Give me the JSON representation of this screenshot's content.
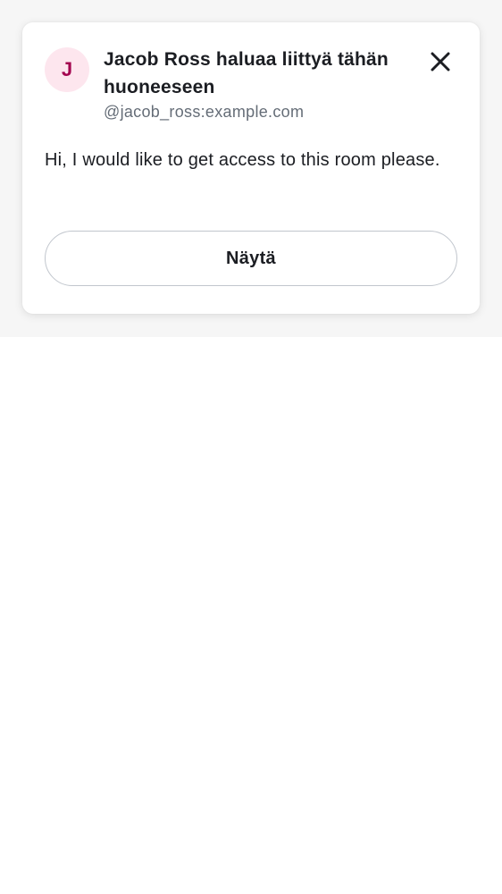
{
  "request": {
    "avatar_initial": "J",
    "title": "Jacob Ross haluaa liittyä tähän huoneeseen",
    "user_id": "@jacob_ross:example.com",
    "message": "Hi, I would like to get access to this room please.",
    "view_button_label": "Näytä"
  },
  "icons": {
    "close": "close-icon"
  },
  "colors": {
    "avatar_background": "#fde6ee",
    "avatar_text": "#a3044f",
    "primary_text": "#1b1d22",
    "secondary_text": "#656d77",
    "button_border": "#c1c6cd"
  }
}
